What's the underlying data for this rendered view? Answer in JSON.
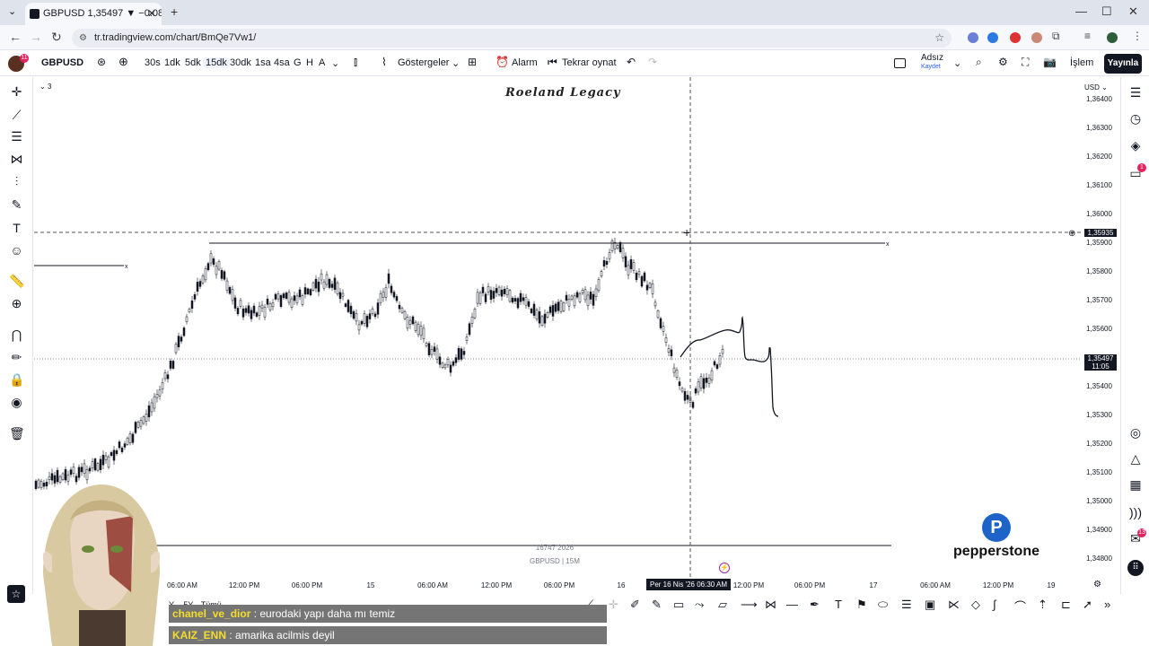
{
  "browser": {
    "tab_title": "GBPUSD 1,35497 ▼ −0.08% Ad",
    "url": "tr.tradingview.com/chart/BmQe7Vw1/"
  },
  "toolbar": {
    "symbol": "GBPUSD",
    "intervals": [
      "30s",
      "1dk",
      "5dk",
      "15dk",
      "30dk",
      "1sa",
      "4sa",
      "G",
      "H",
      "A"
    ],
    "active_interval": "15dk",
    "indicators": "Göstergeler",
    "alarm": "Alarm",
    "replay": "Tekrar oynat",
    "layout_name": "Adsız",
    "layout_saved": "Kaydet",
    "trade": "İşlem",
    "publish": "Yayınla",
    "avatar_badge": "11"
  },
  "chart": {
    "title": "Roeland Legacy",
    "currency": "USD",
    "group_badge": "3",
    "watermark_line1": "16747 2026",
    "watermark_line2": "GBPUSD | 15M",
    "price_ticks": [
      "1,36400",
      "1,36300",
      "1,36200",
      "1,36100",
      "1,36000",
      "1,35900",
      "1,35800",
      "1,35700",
      "1,35600",
      "1,35500",
      "1,35400",
      "1,35300",
      "1,35200",
      "1,35100",
      "1,35000",
      "1,34900",
      "1,34800"
    ],
    "crosshair_price": "1,35935",
    "current_price": "1,35497",
    "countdown": "11:05",
    "time_ticks": [
      "06:00 AM",
      "12:00 PM",
      "06:00 PM",
      "15",
      "06:00 AM",
      "12:00 PM",
      "06:00 PM",
      "16",
      "12:00 PM",
      "06:00 PM",
      "17",
      "06:00 AM",
      "12:00 PM",
      "19"
    ],
    "crosshair_time": "Per 16 Nis '26   06:30 AM",
    "range_buttons": [
      "Y",
      "5Y",
      "Tümü"
    ],
    "right_badge_alerts": "1",
    "right_badge_notif": "13"
  },
  "chat": [
    {
      "user": "chanel_ve_dior",
      "message": ": eurodaki yapı daha mı temiz"
    },
    {
      "user": "KAIZ_ENN",
      "message": ": amarika acilmis deyil"
    }
  ],
  "sponsor": "pepperstone",
  "colors": {
    "accent": "#131722",
    "up": "#9aa6a0",
    "chat_user": "#f5dd2b",
    "sponsor_blue": "#1e64c8"
  }
}
